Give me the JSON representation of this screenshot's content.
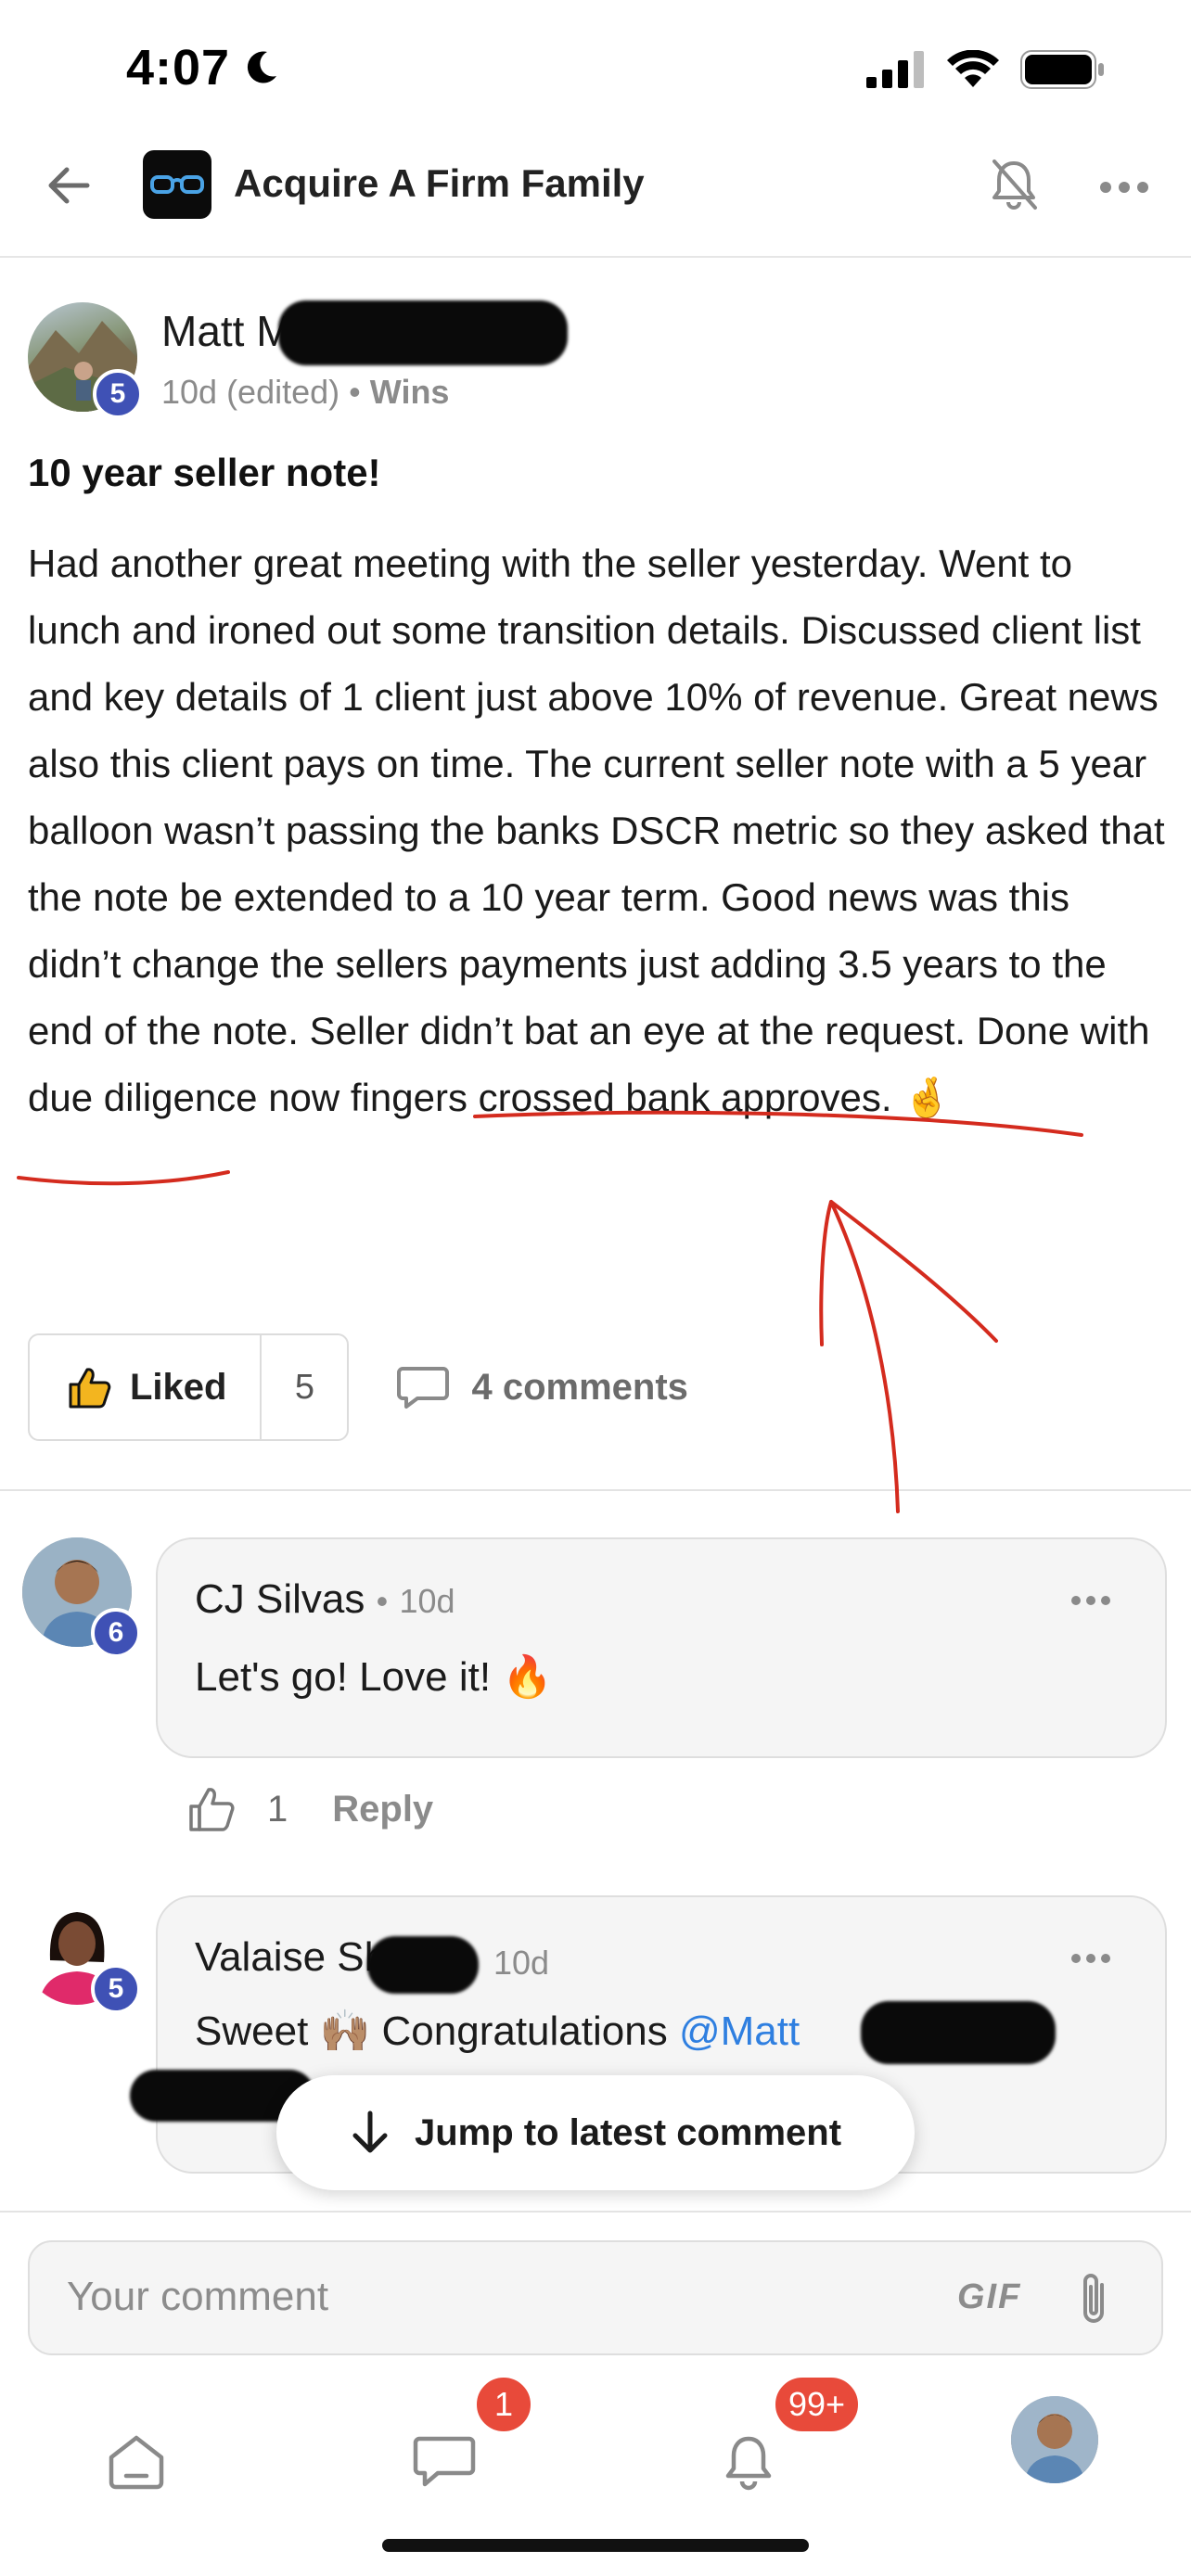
{
  "status_bar": {
    "time": "4:07",
    "icons": [
      "moon-icon",
      "cellular-signal-icon",
      "wifi-icon",
      "battery-icon"
    ]
  },
  "header": {
    "group_name": "Acquire A Firm Family",
    "icons": [
      "back-arrow-icon",
      "glasses-logo-icon",
      "bell-muted-icon",
      "ellipsis-icon"
    ]
  },
  "post": {
    "author_visible": "Matt Ma",
    "author_level": "5",
    "time": "10d (edited)",
    "separator": "•",
    "category": "Wins",
    "title": "10 year seller note!",
    "body_part1": "Had another great meeting with the seller yesterday. Went to lunch and ironed out some transition details. Discussed client list and key details of 1 client just above 10% of revenue. Great news also this client pays on time. The current seller note with a 5 year balloon wasn’t passing the banks DSCR metric so they asked that the note be extended to a 10 year term. Good news was this didn’t change the sellers payments just adding 3.5 years to the end of the note. ",
    "body_highlight": "Seller didn’t bat an eye at the request.",
    "body_part2": " Done with due diligence now fingers crossed bank approves. 🤞",
    "like_label": "Liked",
    "like_count": "5",
    "comments_label": "4 comments",
    "annotation_color": "#d42b1e"
  },
  "comments": [
    {
      "name": "CJ Silvas",
      "time": "10d",
      "level": "6",
      "text": "Let's go! Love it! 🔥",
      "like_count": "1",
      "reply_label": "Reply"
    },
    {
      "name_visible": "Valaise Sh",
      "time": "10d",
      "level": "5",
      "text_prefix": "Sweet 🙌🏽 Congratulations ",
      "mention_visible": "@Matt"
    }
  ],
  "jump_button": {
    "label": "Jump to latest comment"
  },
  "composer": {
    "placeholder": "Your comment",
    "gif_label": "GIF"
  },
  "tab_bar": {
    "chat_badge": "1",
    "notifications_badge": "99+"
  },
  "colors": {
    "level_badge": "#3f51b5",
    "notification_badge": "#e84a3a",
    "mention": "#2f7fe0"
  }
}
